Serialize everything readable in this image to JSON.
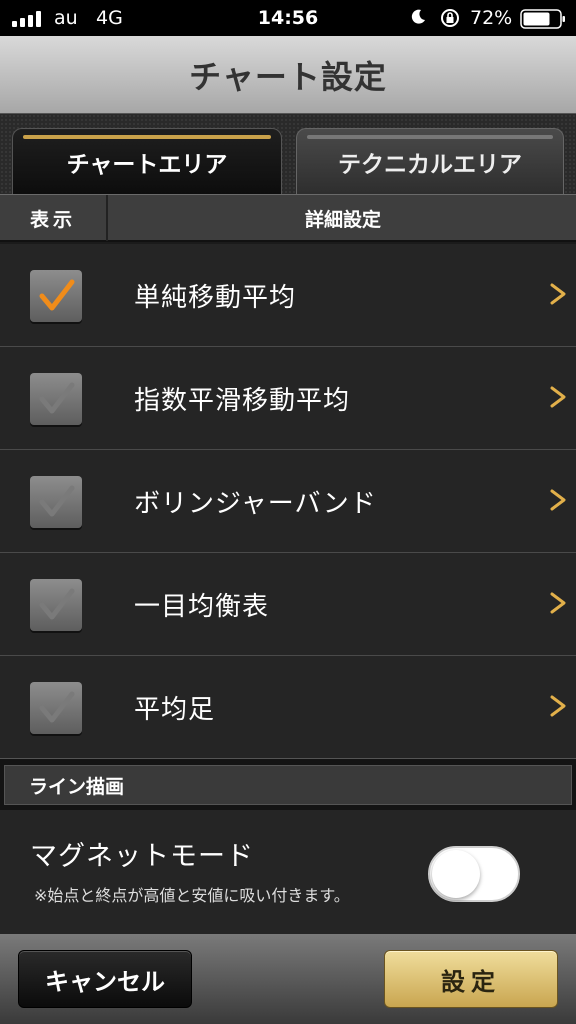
{
  "status_bar": {
    "carrier": "au",
    "network": "4G",
    "time": "14:56",
    "battery": "72%"
  },
  "header": {
    "title": "チャート設定"
  },
  "tabs": [
    {
      "label": "チャートエリア",
      "active": true
    },
    {
      "label": "テクニカルエリア",
      "active": false
    }
  ],
  "columns": {
    "display": "表示",
    "detail": "詳細設定"
  },
  "indicators": [
    {
      "label": "単純移動平均",
      "checked": true,
      "check_color": "#f08c1a"
    },
    {
      "label": "指数平滑移動平均",
      "checked": false,
      "check_color": "#7a7a7a"
    },
    {
      "label": "ボリンジャーバンド",
      "checked": false,
      "check_color": "#7a7a7a"
    },
    {
      "label": "一目均衡表",
      "checked": false,
      "check_color": "#7a7a7a"
    },
    {
      "label": "平均足",
      "checked": false,
      "check_color": "#7a7a7a"
    }
  ],
  "line_section": {
    "title": "ライン描画",
    "magnet_label": "マグネットモード",
    "magnet_note": "※始点と終点が高値と安値に吸い付きます。",
    "magnet_enabled": false
  },
  "footer": {
    "cancel_label": "キャンセル",
    "confirm_label": "設定"
  },
  "colors": {
    "accent_gold": "#c9a14a",
    "chevron": "#e2b04a",
    "active_check": "#f08c1a"
  }
}
